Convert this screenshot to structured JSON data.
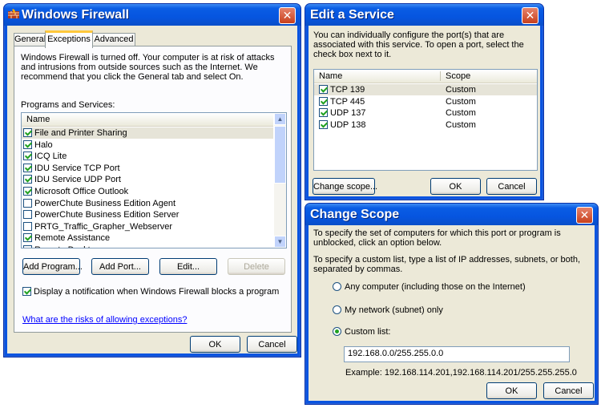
{
  "firewall": {
    "title": "Windows Firewall",
    "close": "✕",
    "tabs": [
      "General",
      "Exceptions",
      "Advanced"
    ],
    "info": "Windows Firewall is turned off. Your computer is at risk of attacks and intrusions from outside sources such as the Internet. We recommend that you click the General tab and select On.",
    "programs_label": "Programs and Services:",
    "column_name": "Name",
    "programs": [
      {
        "name": "File and Printer Sharing",
        "checked": true
      },
      {
        "name": "Halo",
        "checked": true
      },
      {
        "name": "ICQ Lite",
        "checked": true
      },
      {
        "name": "IDU Service TCP Port",
        "checked": true
      },
      {
        "name": "IDU Service UDP Port",
        "checked": true
      },
      {
        "name": "Microsoft Office Outlook",
        "checked": true
      },
      {
        "name": "PowerChute Business Edition Agent",
        "checked": false
      },
      {
        "name": "PowerChute Business Edition Server",
        "checked": false
      },
      {
        "name": "PRTG_Traffic_Grapher_Webserver",
        "checked": false
      },
      {
        "name": "Remote Assistance",
        "checked": true
      },
      {
        "name": "Remote Desktop",
        "checked": false
      }
    ],
    "add_program": "Add Program...",
    "add_port": "Add Port...",
    "edit": "Edit...",
    "delete": "Delete",
    "notify_label": "Display a notification when Windows Firewall blocks a program",
    "risk_link": "What are the risks of allowing exceptions?",
    "ok": "OK",
    "cancel": "Cancel"
  },
  "edit_service": {
    "title": "Edit a Service",
    "close": "✕",
    "info": "You can individually configure the port(s) that are associated with this service. To open a port, select the check box next to it.",
    "col_name": "Name",
    "col_scope": "Scope",
    "ports": [
      {
        "name": "TCP 139",
        "scope": "Custom",
        "checked": true
      },
      {
        "name": "TCP 445",
        "scope": "Custom",
        "checked": true
      },
      {
        "name": "UDP 137",
        "scope": "Custom",
        "checked": true
      },
      {
        "name": "UDP 138",
        "scope": "Custom",
        "checked": true
      }
    ],
    "change_scope": "Change scope...",
    "ok": "OK",
    "cancel": "Cancel"
  },
  "change_scope": {
    "title": "Change Scope",
    "close": "✕",
    "info1": "To specify the set of computers for which this port or program is unblocked, click an option below.",
    "info2": "To specify a custom list, type a list of IP addresses, subnets, or both, separated by commas.",
    "opt_any": "Any computer (including those on the Internet)",
    "opt_network": "My network (subnet) only",
    "opt_custom": "Custom list:",
    "custom_value": "192.168.0.0/255.255.0.0",
    "example": "Example: 192.168.114.201,192.168.114.201/255.255.255.0",
    "ok": "OK",
    "cancel": "Cancel"
  }
}
